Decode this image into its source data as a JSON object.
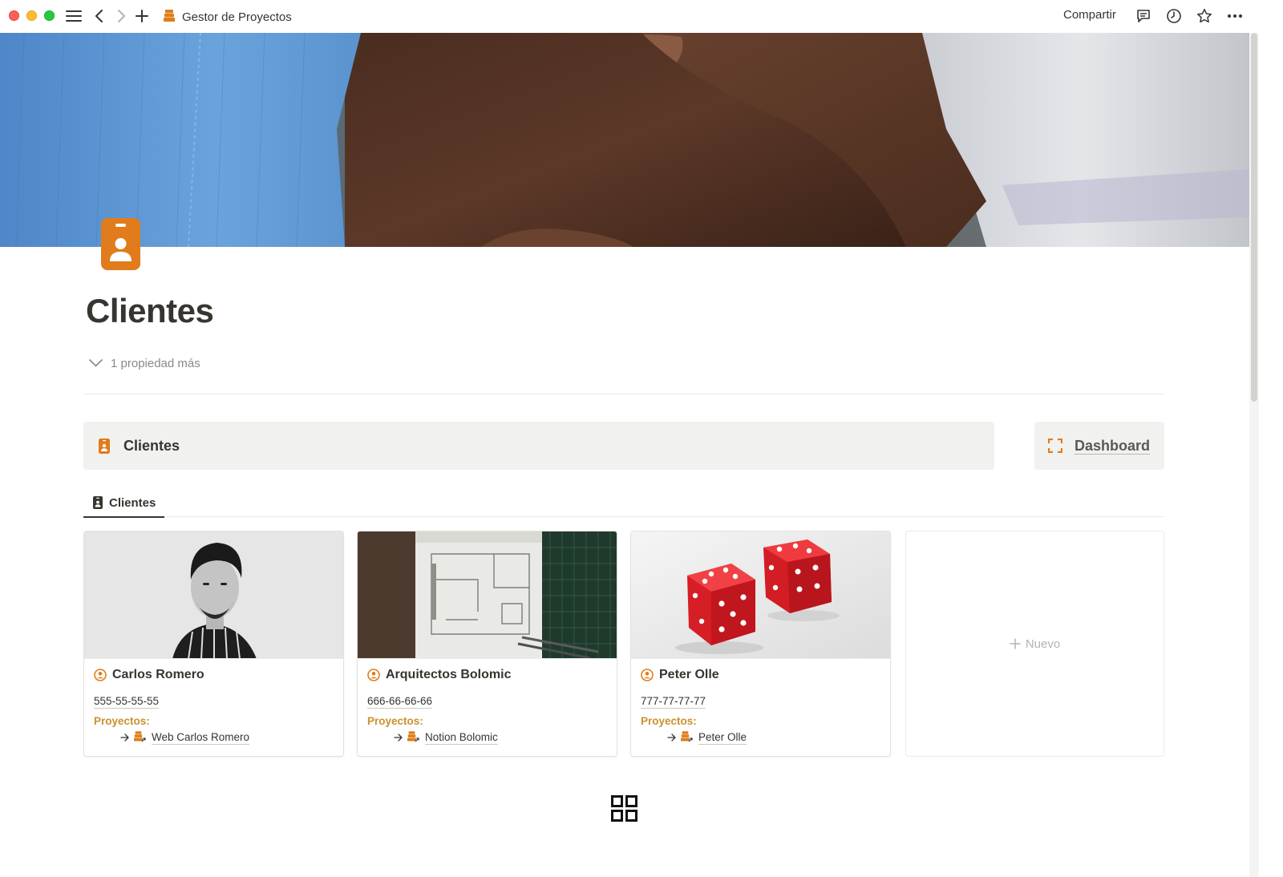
{
  "topbar": {
    "title": "Gestor de Proyectos",
    "share_label": "Compartir",
    "icons": [
      "menu-icon",
      "back-icon",
      "forward-icon",
      "add-icon",
      "comments-icon",
      "history-icon",
      "star-icon",
      "more-icon"
    ]
  },
  "page": {
    "title": "Clientes",
    "more_properties": "1 propiedad más",
    "accent_color": "#e07c1b"
  },
  "callouts": {
    "main_label": "Clientes",
    "dashboard_label": "Dashboard"
  },
  "view_tab": {
    "label": "Clientes"
  },
  "cards": [
    {
      "name": "Carlos Romero",
      "phone": "555-55-55-55",
      "projects_label": "Proyectos:",
      "project": "Web Carlos Romero"
    },
    {
      "name": "Arquitectos Bolomic",
      "phone": "666-66-66-66",
      "projects_label": "Proyectos:",
      "project": "Notion Bolomic"
    },
    {
      "name": "Peter Olle",
      "phone": "777-77-77-77",
      "projects_label": "Proyectos:",
      "project": "Peter Olle"
    }
  ],
  "new_card": {
    "label": "Nuevo"
  },
  "colors": {
    "accent_orange": "#e07c1b",
    "projects_label": "#cb912f",
    "callout_bg": "#f1f1ef",
    "text": "#37352f"
  }
}
